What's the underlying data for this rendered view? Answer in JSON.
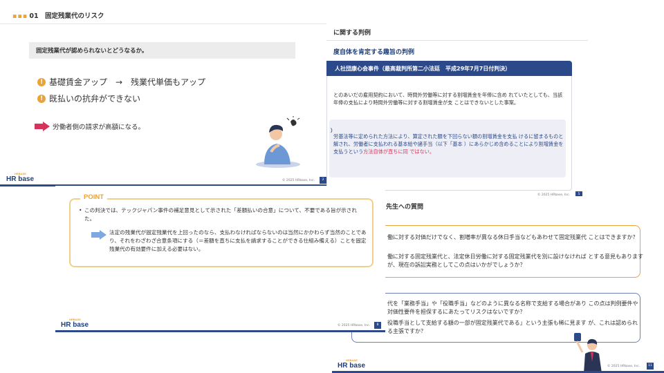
{
  "slide_a": {
    "header": "01　固定残業代のリスク",
    "header_dots": "▪▪▪",
    "question": "固定残業代が認められないとどうなるか。",
    "bullets": [
      "基礎賃金アップ　→　残業代単価もアップ",
      "既払いの抗弁ができない"
    ],
    "arrow_text": "労働者側の請求が高額になる。",
    "logo": "HR base",
    "logo_tag": "HRBASE",
    "copyright": "© 2025 HRbase, Inc.",
    "page": "2"
  },
  "slide_b": {
    "title": "に関する判例",
    "subtitle": "度自体を肯定する趣旨の判例",
    "case_bar": "人社団康心会事件（最高裁判所第二小法廷　平成29年7月7日付判決）",
    "para1": "とのあいだの雇用契約において、時間外労働等に対する割増賃金を年俸に含め れていたとしても、当該年俸の支払により時間外労働等に対する割増賃金が支 ことはできないとした事案。",
    "para2_mark": "）",
    "para2": "労基法等に定められた方法により、算定された額を下回らない額の割増賃金を支払 けるに留まるものと解され、労働者に支払われる基本給や諸手当（以下「基本 ）にあらかじめ含めることにより割増賃金を支払うという",
    "para2_red": "方法自体が直ちに同 ではない。",
    "copyright": "© 2025 HRbase, Inc.",
    "page": "5"
  },
  "slide_c": {
    "point_label": "POINT",
    "bullet1": "この判決では、テックジャパン事件の補足意見として示された「差額払いの合意」について、不要である旨が示された。",
    "bullet2": "法定の残業代が固定残業代を上回ったのなら、支払わなければならないのは当然にかかわらず当然のことであり、それをわざわざ合意条項にする（＝差額を直ちに支払を請求することができる仕組み備える）ことを固定残業代の有効要件に加える必要はない。",
    "logo": "HR base",
    "logo_tag": "HRBASE",
    "copyright": "© 2025 HRbase, Inc.",
    "page": "8"
  },
  "slide_d": {
    "title": "先生への質問",
    "q1a": "働に対する対価だけでなく、割増率が異なる休日手当などもあわせて固定残業代 ことはできますか？",
    "q1b": "働に対する固定残業代と、法定休日労働に対する固定残業代を別に設けなければ とする意見もありますが、現在の訴訟実務としてこの点はいかがでしょうか？",
    "q2a": "代を「業務手当」や「役職手当」などのように異なる名称で支給する場合があり この点は判例要件や対価性要件を担保するにあたってリスクはないですか？",
    "q2b": "役職手当として支給する額の一部が固定残業代である」という主張も稀に見ます が、これは認められる主張ですか？",
    "logo": "HR base",
    "logo_tag": "HRBASE",
    "copyright": "© 2025 HRbase, Inc.",
    "page": "11"
  },
  "colors": {
    "accent_orange": "#e8a33a",
    "navy": "#2c4a8a",
    "red_arrow": "#d6335a",
    "light_blue_arrow": "#7fa8e0"
  }
}
